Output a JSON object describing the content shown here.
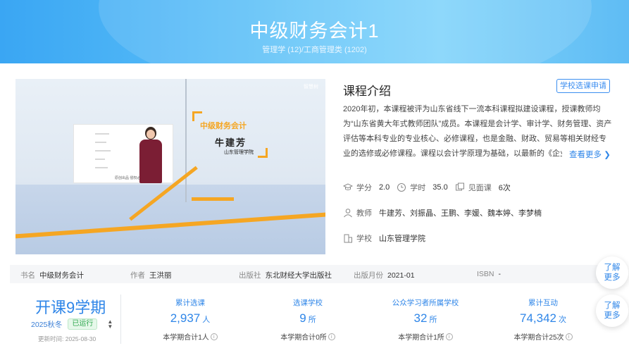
{
  "header": {
    "title": "中级财务会计1",
    "subtitle": "管理学 (12)/工商管理类 (1202)"
  },
  "video": {
    "logo_text": "智慧树",
    "course_name": "中级财务会计",
    "teacher_name": "牛建芳",
    "school_name": "山东管理学院",
    "slide_caption": "原创出品 侵权必究"
  },
  "intro": {
    "title": "课程介绍",
    "apply_label": "学校选课申请",
    "text": "2020年初，本课程被评为山东省线下一流本科课程拟建设课程，授课教师均为“山东省黄大年式教师团队”成员。本课程是会计学、审计学、财务管理、资产评估等本科专业的专业核心、必修课程，也是金融、财政、贸易等相关财经专业的选修或必修课程。课程以会计学原理为基础，以最新的《企业",
    "more_label": "查看更多"
  },
  "meta": {
    "credit_label": "学分",
    "credit_value": "2.0",
    "hours_label": "学时",
    "hours_value": "35.0",
    "meet_label": "见面课",
    "meet_value": "6次",
    "teacher_label": "教师",
    "teachers": "牛建芳、刘振晶、王鹏、李媛、魏本婷、李梦楠",
    "school_label": "学校",
    "school_value": "山东管理学院"
  },
  "book": {
    "name_label": "书名",
    "name_value": "中级财务会计",
    "author_label": "作者",
    "author_value": "王洪丽",
    "publisher_label": "出版社",
    "publisher_value": "东北财经大学出版社",
    "date_label": "出版月份",
    "date_value": "2021-01",
    "isbn_label": "ISBN",
    "isbn_value": "-"
  },
  "stats": {
    "term_title": "开课9学期",
    "term_select": "2025秋冬",
    "term_status": "已运行",
    "update_label": "更新时间:",
    "update_date": "2025-08-30",
    "items": [
      {
        "label": "累计选课",
        "value": "2,937",
        "unit": "人",
        "foot": "本学期合计1人"
      },
      {
        "label": "选课学校",
        "value": "9",
        "unit": "所",
        "foot": "本学期合计0所"
      },
      {
        "label": "公众学习者所属学校",
        "value": "32",
        "unit": "所",
        "foot": "本学期合计1所"
      },
      {
        "label": "累计互动",
        "value": "74,342",
        "unit": "次",
        "foot": "本学期合计25次"
      }
    ]
  },
  "float_buttons": {
    "first_line1": "了解",
    "first_line2": "更多",
    "second_line1": "了解",
    "second_line2": "更多"
  },
  "colors": {
    "accent": "#2f86e8",
    "banner": "#5cc0f8",
    "success": "#2fa84f",
    "video_orange": "#f5a623"
  }
}
